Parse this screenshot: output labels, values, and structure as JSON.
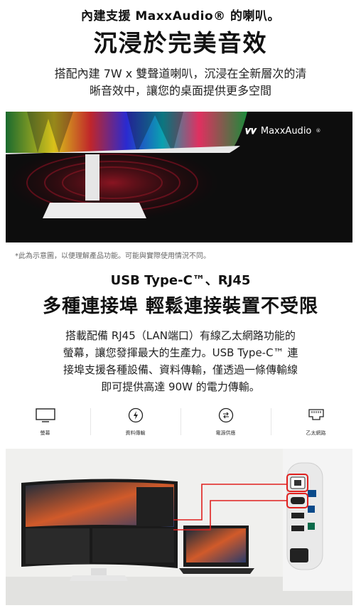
{
  "section1": {
    "eyebrow": "內建支援 MaxxAudio® 的喇叭。",
    "title": "沉浸於完美音效",
    "desc_line1": "搭配內建 7W x 雙聲道喇叭，沉浸在全新層次的清",
    "desc_line2": "晰音效中，讓您的桌面提供更多空間",
    "logo_text": "MaxxAudio",
    "logo_mark": "®"
  },
  "disclaimer": "*此為示意圖，以便理解產品功能。可能與實際使用情況不同。",
  "section2": {
    "eyebrow": "USB Type-C™、RJ45",
    "title": "多種連接埠 輕鬆連接裝置不受限",
    "desc_line1": "搭載配備 RJ45（LAN端口）有線乙太網路功能的",
    "desc_line2": "螢幕，讓您發揮最大的生產力。USB Type-C™ 連",
    "desc_line3": "接埠支援各種設備、資料傳輸，僅透過一條傳輸線",
    "desc_line4": "即可提供高達 90W 的電力傳輸。"
  },
  "features": [
    {
      "icon": "monitor-icon",
      "label": "螢幕"
    },
    {
      "icon": "data-transfer-icon",
      "label": "資料傳輸"
    },
    {
      "icon": "power-delivery-icon",
      "label": "電源供應"
    },
    {
      "icon": "ethernet-icon",
      "label": "乙太網路"
    }
  ],
  "colors": {
    "accent_red": "#e0201e",
    "dark_bg": "#0d0d0d",
    "text": "#111111"
  }
}
